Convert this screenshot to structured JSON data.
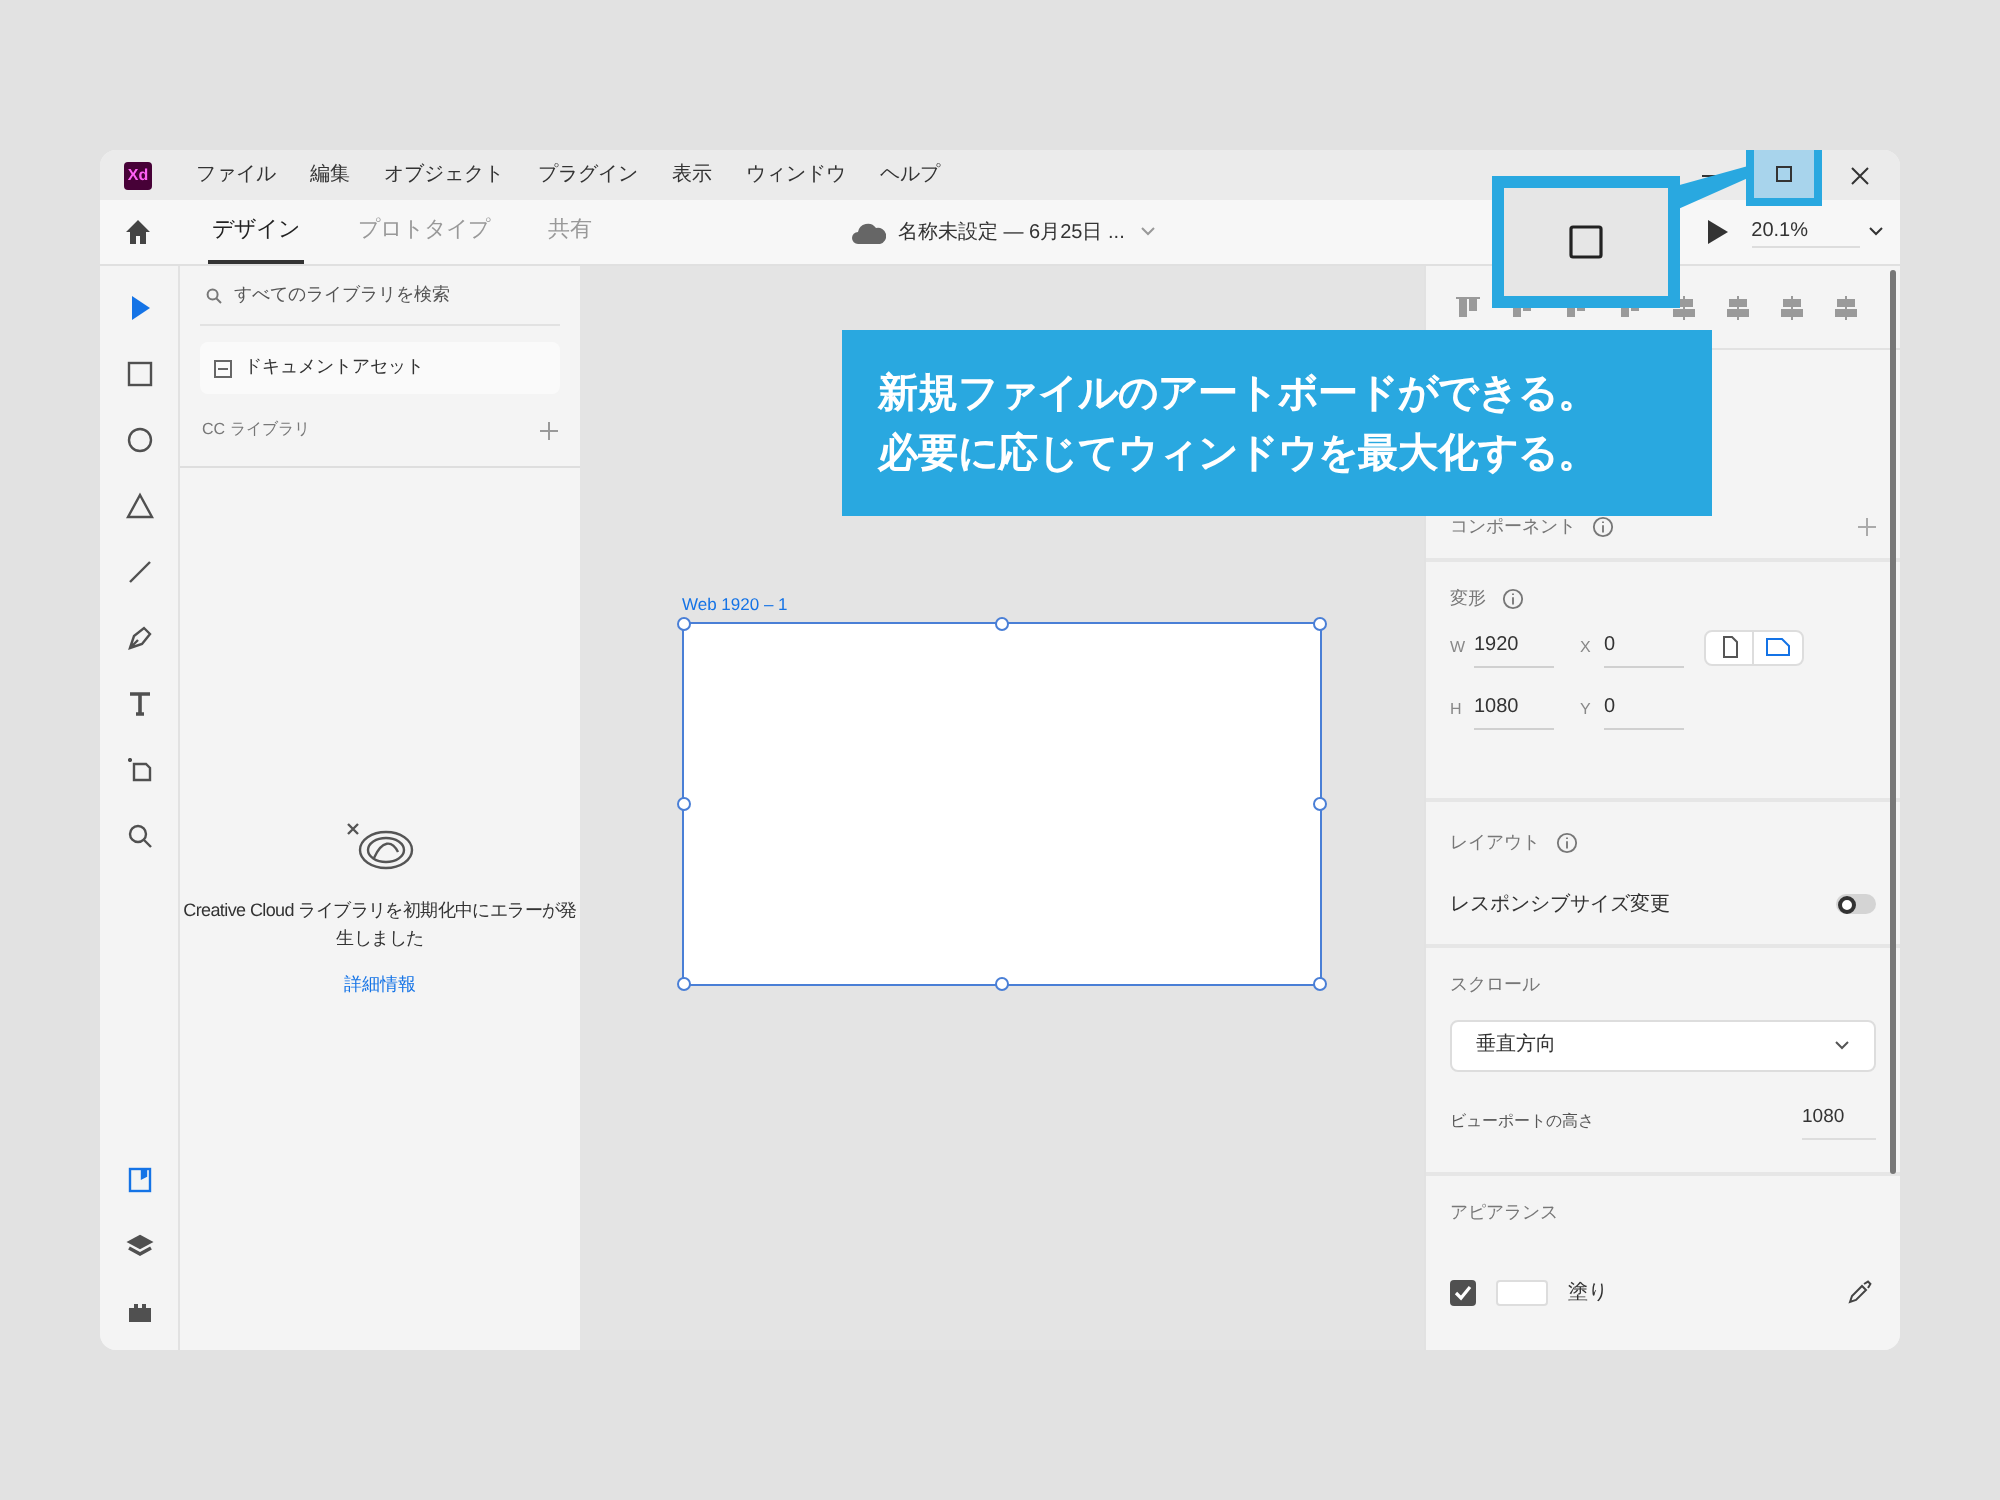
{
  "app_icon": {
    "text": "Xd"
  },
  "menu": [
    "ファイル",
    "編集",
    "オブジェクト",
    "プラグイン",
    "表示",
    "ウィンドウ",
    "ヘルプ"
  ],
  "tabs": [
    {
      "label": "デザイン",
      "selected": true
    },
    {
      "label": "プロトタイプ",
      "selected": false
    },
    {
      "label": "共有",
      "selected": false
    }
  ],
  "document_title": "名称未設定 — 6月25日 ...",
  "zoom": "20.1%",
  "tools": [
    {
      "kind": "select",
      "selected": true
    },
    {
      "kind": "rectangle",
      "selected": false
    },
    {
      "kind": "ellipse",
      "selected": false
    },
    {
      "kind": "polygon",
      "selected": false
    },
    {
      "kind": "line",
      "selected": false
    },
    {
      "kind": "pen",
      "selected": false
    },
    {
      "kind": "text",
      "selected": false
    },
    {
      "kind": "artboard",
      "selected": false
    },
    {
      "kind": "zoom",
      "selected": false
    }
  ],
  "bottom_tools": [
    {
      "kind": "libraries",
      "selected": true
    },
    {
      "kind": "layers",
      "selected": false
    },
    {
      "kind": "plugins",
      "selected": false
    }
  ],
  "library_panel": {
    "search_placeholder": "すべてのライブラリを検索",
    "document_assets": "ドキュメントアセット",
    "cc_libraries": "CC ライブラリ",
    "error_message": "Creative Cloud ライブラリを初期化中にエラーが発生しました",
    "details_link": "詳細情報"
  },
  "artboard": {
    "label": "Web 1920 – 1"
  },
  "properties": {
    "component": "コンポーネント",
    "transform": "変形",
    "fields": [
      {
        "label": "W",
        "value": "1920"
      },
      {
        "label": "X",
        "value": "0"
      },
      {
        "label": "H",
        "value": "1080"
      },
      {
        "label": "Y",
        "value": "0"
      }
    ],
    "orientation": [
      {
        "kind": "portrait",
        "selected": false
      },
      {
        "kind": "landscape",
        "selected": true
      }
    ],
    "layout": "レイアウト",
    "responsive": {
      "label": "レスポンシブサイズ変更",
      "on": false
    },
    "scroll": "スクロール",
    "scroll_value": "垂直方向",
    "viewport_label": "ビューポートの高さ",
    "viewport_value": "1080",
    "appearance": "アピアランス",
    "fill": {
      "label": "塗り",
      "checked": true
    }
  },
  "callout": {
    "lines": [
      "新規ファイルのアートボードができる。",
      "必要に応じてウィンドウを最大化する。"
    ]
  }
}
